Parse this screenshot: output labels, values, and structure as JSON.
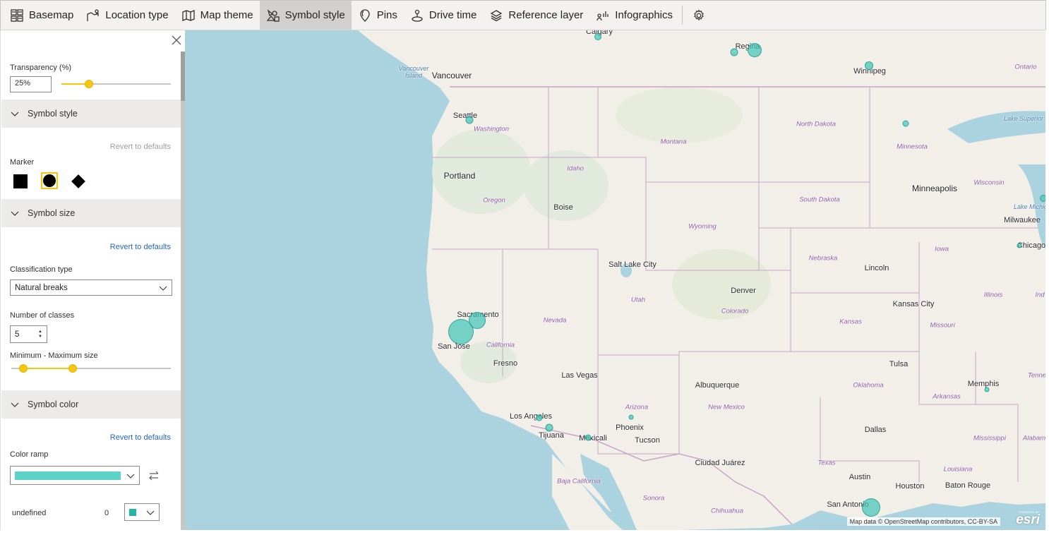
{
  "toolbar": {
    "items": [
      {
        "label": "Basemap",
        "icon": "basemap-icon"
      },
      {
        "label": "Location type",
        "icon": "location-type-icon"
      },
      {
        "label": "Map theme",
        "icon": "map-theme-icon"
      },
      {
        "label": "Symbol style",
        "icon": "symbol-style-icon",
        "active": true
      },
      {
        "label": "Pins",
        "icon": "pins-icon"
      },
      {
        "label": "Drive time",
        "icon": "drive-time-icon"
      },
      {
        "label": "Reference layer",
        "icon": "reference-layer-icon"
      },
      {
        "label": "Infographics",
        "icon": "infographics-icon"
      }
    ],
    "settings_icon": "gear-icon"
  },
  "panel": {
    "transparency": {
      "label": "Transparency (%)",
      "value": "25%",
      "level": 0.25
    },
    "symbol_style": {
      "header": "Symbol style",
      "revert": "Revert to defaults",
      "marker_label": "Marker",
      "markers": [
        "square",
        "circle",
        "diamond"
      ],
      "selected_marker": "circle"
    },
    "symbol_size": {
      "header": "Symbol size",
      "revert": "Revert to defaults",
      "classification_label": "Classification type",
      "classification_value": "Natural breaks",
      "classes_label": "Number of classes",
      "classes_value": "5",
      "size_label": "Minimum - Maximum size"
    },
    "symbol_color": {
      "header": "Symbol color",
      "revert": "Revert to defaults",
      "ramp_label": "Color ramp",
      "ramp_color": "#5bd3c7",
      "class_name": "undefined",
      "class_value": "0",
      "class_color": "#1fb5a8"
    }
  },
  "map": {
    "attribution": "Map data © OpenStreetMap contributors, CC-BY-SA",
    "esri_powered": "POWERED BY",
    "esri_logo": "esri",
    "cities": [
      "Calgary",
      "Regina",
      "Winnipeg",
      "Vancouver",
      "Seattle",
      "Portland",
      "Boise",
      "Minneapolis",
      "Milwaukee",
      "Chicago",
      "Salt Lake City",
      "Lincoln",
      "Denver",
      "Kansas City",
      "Sacramento",
      "San Jose",
      "Fresno",
      "Las Vegas",
      "Tulsa",
      "Memphis",
      "Albuquerque",
      "Los Angeles",
      "Tijuana",
      "Mexicali",
      "Phoenix",
      "Tucson",
      "Dallas",
      "Ciudad Juárez",
      "Austin",
      "Houston",
      "Baton Rouge",
      "San Antonio"
    ],
    "regions": [
      "Washington",
      "Montana",
      "North Dakota",
      "Minnesota",
      "Idaho",
      "Oregon",
      "Wyoming",
      "South Dakota",
      "Wisconsin",
      "Iowa",
      "Nebraska",
      "Utah",
      "Colorado",
      "Illinois",
      "Ind",
      "Nevada",
      "California",
      "Kansas",
      "Missouri",
      "Oklahoma",
      "Arkansas",
      "Tenne",
      "Arizona",
      "New Mexico",
      "Mississippi",
      "Alabam",
      "Texas",
      "Louisiana",
      "Baja California",
      "Sonora",
      "Chihuahua",
      "Ontario"
    ],
    "water": [
      "Vancouver Island",
      "Lake Superior",
      "Lake Michig"
    ]
  }
}
